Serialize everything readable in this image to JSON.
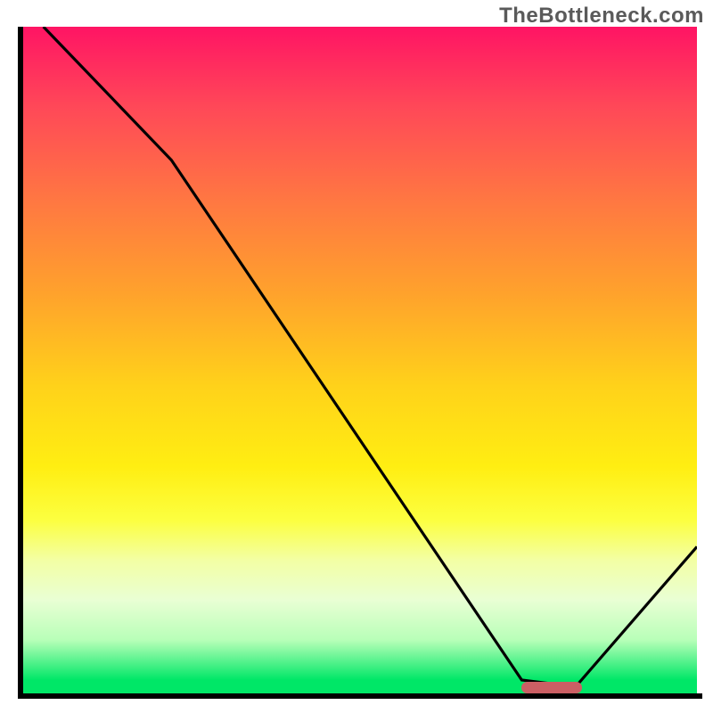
{
  "watermark": "TheBottleneck.com",
  "chart_data": {
    "type": "line",
    "title": "",
    "xlabel": "",
    "ylabel": "",
    "xlim": [
      0,
      100
    ],
    "ylim": [
      0,
      100
    ],
    "curve": [
      {
        "x": 3,
        "y": 100
      },
      {
        "x": 22,
        "y": 80
      },
      {
        "x": 74,
        "y": 2
      },
      {
        "x": 82,
        "y": 1
      },
      {
        "x": 100,
        "y": 22
      }
    ],
    "optimal_band": {
      "x_start": 74,
      "x_end": 83,
      "y": 1
    },
    "gradient_stops": [
      {
        "pos": 0,
        "color": "#ff1464"
      },
      {
        "pos": 12,
        "color": "#ff4858"
      },
      {
        "pos": 26,
        "color": "#ff7742"
      },
      {
        "pos": 40,
        "color": "#ffa22c"
      },
      {
        "pos": 54,
        "color": "#ffd21a"
      },
      {
        "pos": 66,
        "color": "#ffee12"
      },
      {
        "pos": 74,
        "color": "#fcff40"
      },
      {
        "pos": 80,
        "color": "#f3ffa4"
      },
      {
        "pos": 86,
        "color": "#e9ffd4"
      },
      {
        "pos": 92,
        "color": "#b8ffb8"
      },
      {
        "pos": 98,
        "color": "#00e767"
      },
      {
        "pos": 100,
        "color": "#00e767"
      }
    ]
  }
}
